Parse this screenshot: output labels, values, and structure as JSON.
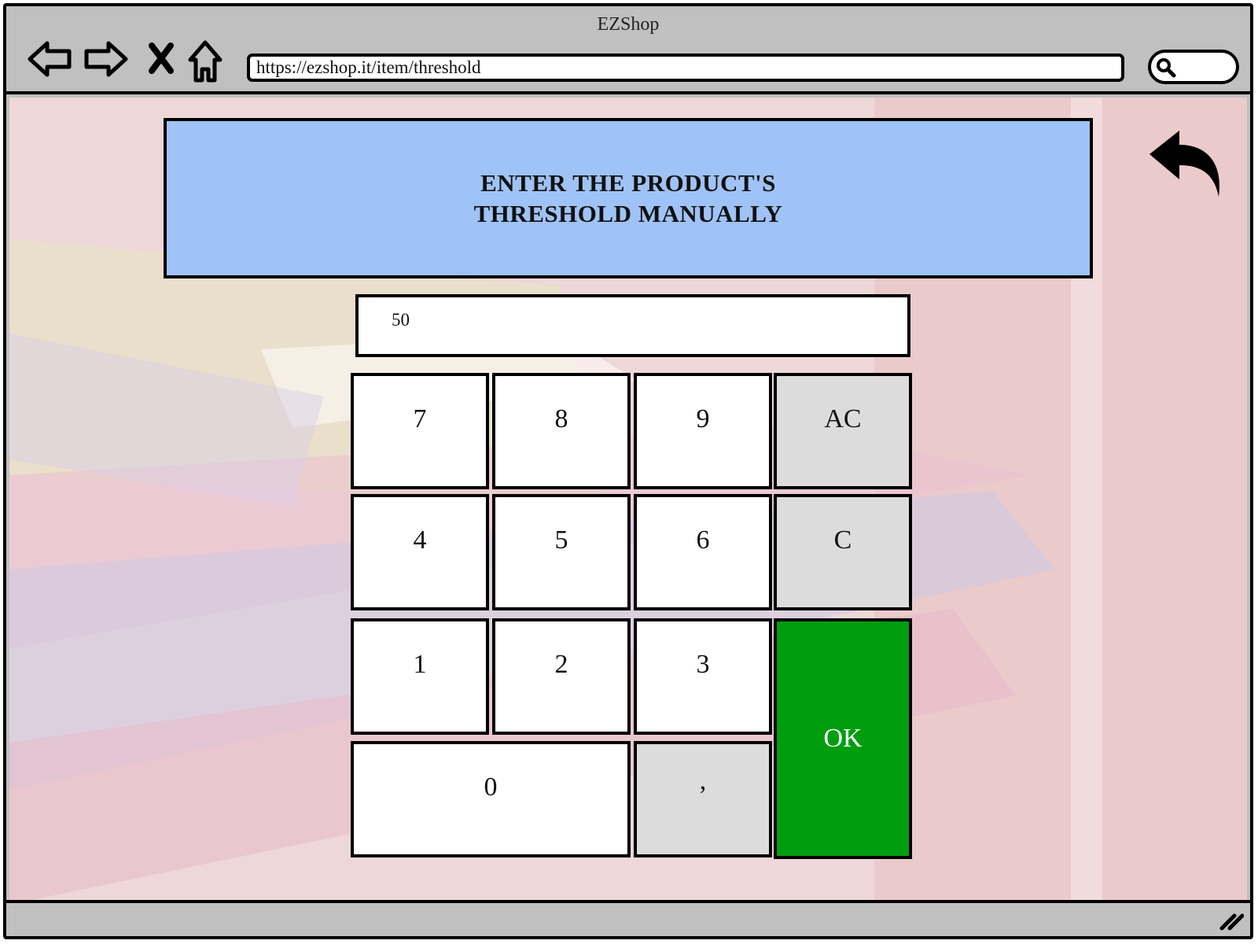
{
  "window": {
    "title": "EZShop"
  },
  "toolbar": {
    "url": "https://ezshop.it/item/threshold",
    "icons": [
      "back-arrow-icon",
      "forward-arrow-icon",
      "stop-icon",
      "home-icon",
      "search-icon"
    ]
  },
  "page": {
    "heading": "ENTER THE PRODUCT'S\nTHRESHOLD MANUALLY",
    "display_value": "50",
    "return_icon": "return-arrow-icon"
  },
  "keypad": {
    "k7": "7",
    "k8": "8",
    "k9": "9",
    "ac": "AC",
    "k4": "4",
    "k5": "5",
    "k6": "6",
    "c": "C",
    "k1": "1",
    "k2": "2",
    "k3": "3",
    "ok": "OK",
    "k0": "0",
    "comma": ","
  },
  "colors": {
    "header_bg": "#9fc3f6",
    "ok_bg": "#009e0f",
    "function_key_bg": "#dcdcdc",
    "chrome_bg": "#c0c0c0"
  }
}
